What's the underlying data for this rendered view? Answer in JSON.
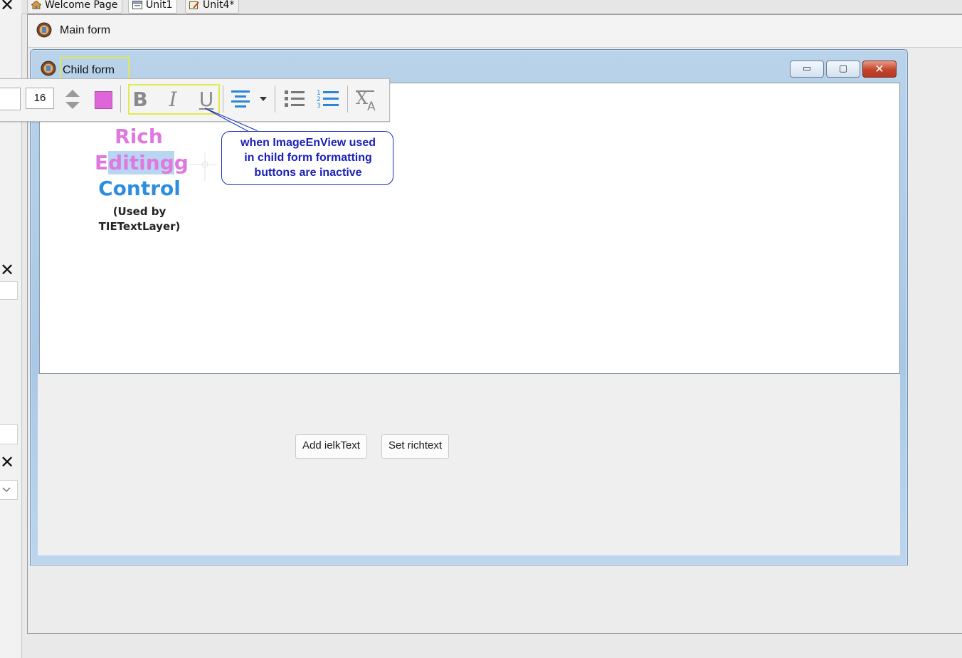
{
  "ide": {
    "tabs": [
      {
        "label": "Welcome Page",
        "icon": "home-icon"
      },
      {
        "label": "Unit1",
        "icon": "form-icon"
      },
      {
        "label": "Unit4*",
        "icon": "edit-form-icon"
      }
    ],
    "close_glyph": "✕"
  },
  "main_form": {
    "title": "Main form",
    "icon": "app-logo-icon"
  },
  "child_form": {
    "title": "Child form",
    "icon": "app-logo-icon",
    "caption_buttons": {
      "minimize": "▭",
      "maximize": "▢",
      "close": "✕"
    }
  },
  "toolbar": {
    "font_size": "16",
    "text_color": "#df66d9",
    "bold_label": "B",
    "italic_label": "I",
    "underline_label": "U",
    "icons": [
      "spin-up-icon",
      "spin-down-icon",
      "align-center-icon",
      "chevron-down-icon",
      "bullet-list-icon",
      "numbered-list-icon",
      "clear-formatting-icon"
    ]
  },
  "editor_text": {
    "line1": "Rich",
    "line2_before": "E",
    "line2_selected": "diting",
    "line2_after": "g",
    "line3": "Control",
    "line4": "(Used by",
    "line5": "TIETextLayer)"
  },
  "callout": {
    "line1": "when ImageEnView used",
    "line2": "in child form formatting",
    "line3": "buttons are inactive"
  },
  "buttons": {
    "add_label": "Add ielkText",
    "set_label": "Set richtext"
  },
  "colors": {
    "rich_pink": "#df78df",
    "control_blue": "#2f8de0",
    "callout_blue": "#1b20b8",
    "highlight_yellow": "#e4e84f"
  }
}
